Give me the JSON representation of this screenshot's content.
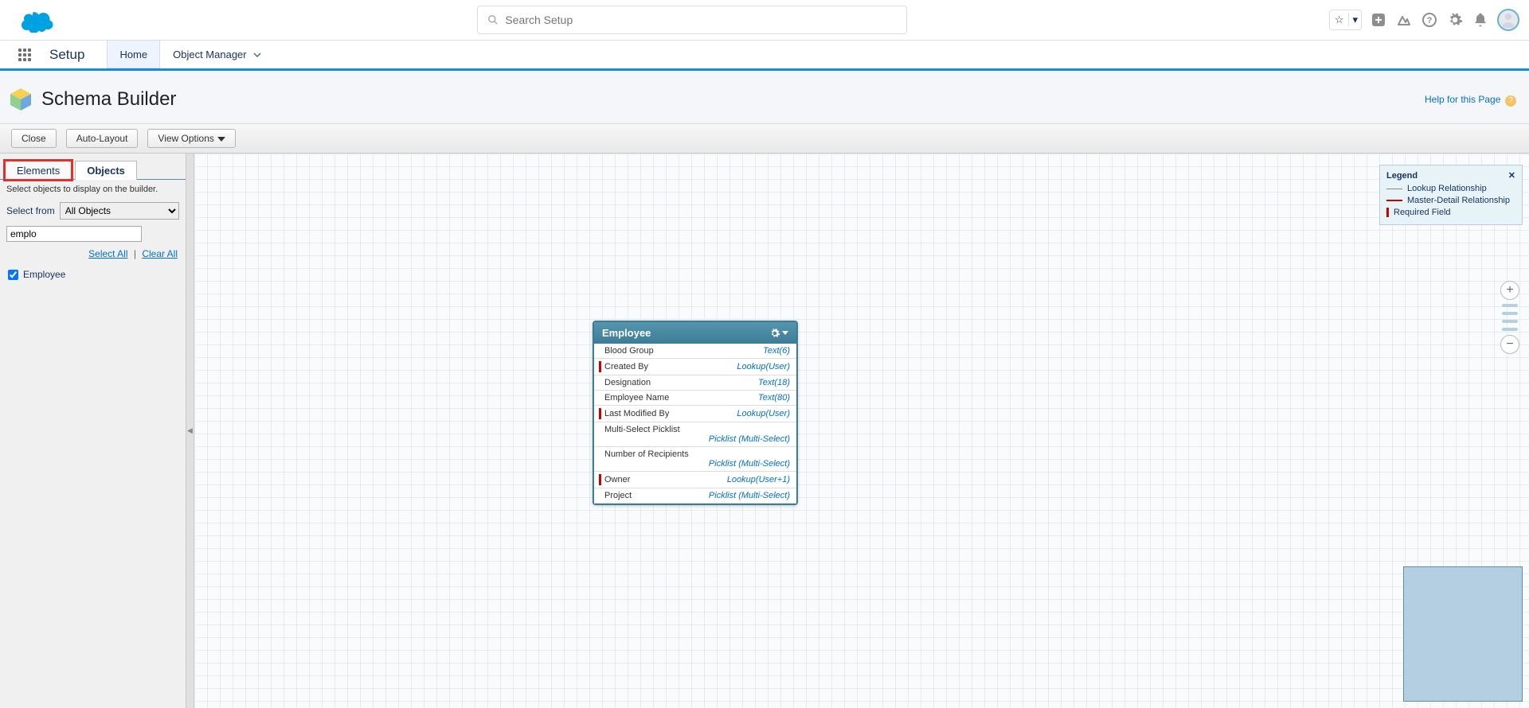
{
  "header": {
    "search_placeholder": "Search Setup"
  },
  "context": {
    "app_name": "Setup",
    "nav": [
      {
        "label": "Home",
        "active": true
      },
      {
        "label": "Object Manager",
        "active": false,
        "has_dropdown": true
      }
    ]
  },
  "page": {
    "title": "Schema Builder",
    "help_text": "Help for this Page"
  },
  "toolbar": {
    "close": "Close",
    "auto_layout": "Auto-Layout",
    "view_options": "View Options"
  },
  "sidebar": {
    "tabs": {
      "elements": "Elements",
      "objects": "Objects"
    },
    "instructions": "Select objects to display on the builder.",
    "select_from_label": "Select from",
    "select_from_value": "All Objects",
    "filter_value": "emplo",
    "select_all": "Select All",
    "clear_all": "Clear All",
    "objects": [
      {
        "label": "Employee",
        "checked": true
      }
    ]
  },
  "legend": {
    "title": "Legend",
    "lookup": "Lookup Relationship",
    "master_detail": "Master-Detail Relationship",
    "required": "Required Field"
  },
  "entity": {
    "name": "Employee",
    "fields": [
      {
        "name": "Blood Group",
        "type": "Text(6)",
        "required": false
      },
      {
        "name": "Created By",
        "type": "Lookup(User)",
        "required": true
      },
      {
        "name": "Designation",
        "type": "Text(18)",
        "required": false
      },
      {
        "name": "Employee Name",
        "type": "Text(80)",
        "required": false
      },
      {
        "name": "Last Modified By",
        "type": "Lookup(User)",
        "required": true
      },
      {
        "name": "Multi-Select Picklist",
        "type": "Picklist (Multi-Select)",
        "required": false,
        "two_line": true
      },
      {
        "name": "Number of Recipients",
        "type": "Picklist (Multi-Select)",
        "required": false,
        "two_line": true
      },
      {
        "name": "Owner",
        "type": "Lookup(User+1)",
        "required": true
      },
      {
        "name": "Project",
        "type": "Picklist (Multi-Select)",
        "required": false
      }
    ]
  }
}
